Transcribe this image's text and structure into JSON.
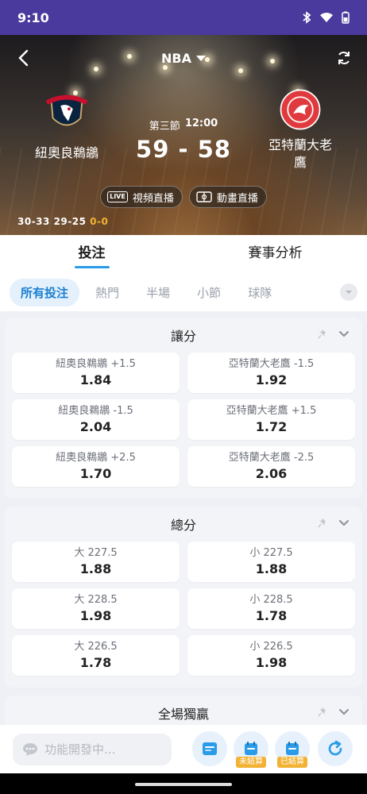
{
  "status": {
    "time": "9:10"
  },
  "header": {
    "league": "NBA"
  },
  "match": {
    "home_name": "紐奧良鵜鶘",
    "away_name_line1": "亞特蘭大老",
    "away_name_line2": "鷹",
    "period": "第三節",
    "clock": "12:00",
    "score": "59 - 58",
    "live_video": "視頻直播",
    "live_anim": "動畫直播",
    "live_tag": "LIVE",
    "q1": "30-33",
    "q2": "29-25",
    "q3": "0-0"
  },
  "main_tabs": [
    "投注",
    "賽事分析"
  ],
  "filters": [
    "所有投注",
    "熱門",
    "半場",
    "小節",
    "球隊"
  ],
  "markets": [
    {
      "title": "讓分",
      "odds": [
        {
          "label": "紐奧良鵜鶘 +1.5",
          "value": "1.84"
        },
        {
          "label": "亞特蘭大老鷹 -1.5",
          "value": "1.92"
        },
        {
          "label": "紐奧良鵜鶘 -1.5",
          "value": "2.04"
        },
        {
          "label": "亞特蘭大老鷹 +1.5",
          "value": "1.72"
        },
        {
          "label": "紐奧良鵜鶘 +2.5",
          "value": "1.70"
        },
        {
          "label": "亞特蘭大老鷹 -2.5",
          "value": "2.06"
        }
      ]
    },
    {
      "title": "總分",
      "odds": [
        {
          "label": "大 227.5",
          "value": "1.88"
        },
        {
          "label": "小 227.5",
          "value": "1.88"
        },
        {
          "label": "大 228.5",
          "value": "1.98"
        },
        {
          "label": "小 228.5",
          "value": "1.78"
        },
        {
          "label": "大 226.5",
          "value": "1.78"
        },
        {
          "label": "小 226.5",
          "value": "1.98"
        }
      ]
    },
    {
      "title": "全場獨贏"
    }
  ],
  "bottom": {
    "chat_placeholder": "功能開發中...",
    "unsettled": "未結算",
    "settled": "已結算"
  },
  "colors": {
    "accent": "#2a9be8",
    "status_bar": "#4a3a9e",
    "badge": "#f2b233"
  },
  "icons": [
    "back-arrow-icon",
    "refresh-icon",
    "pin-icon",
    "chevron-down-icon",
    "chat-bubble-icon",
    "wallet-icon",
    "calendar-icon"
  ]
}
